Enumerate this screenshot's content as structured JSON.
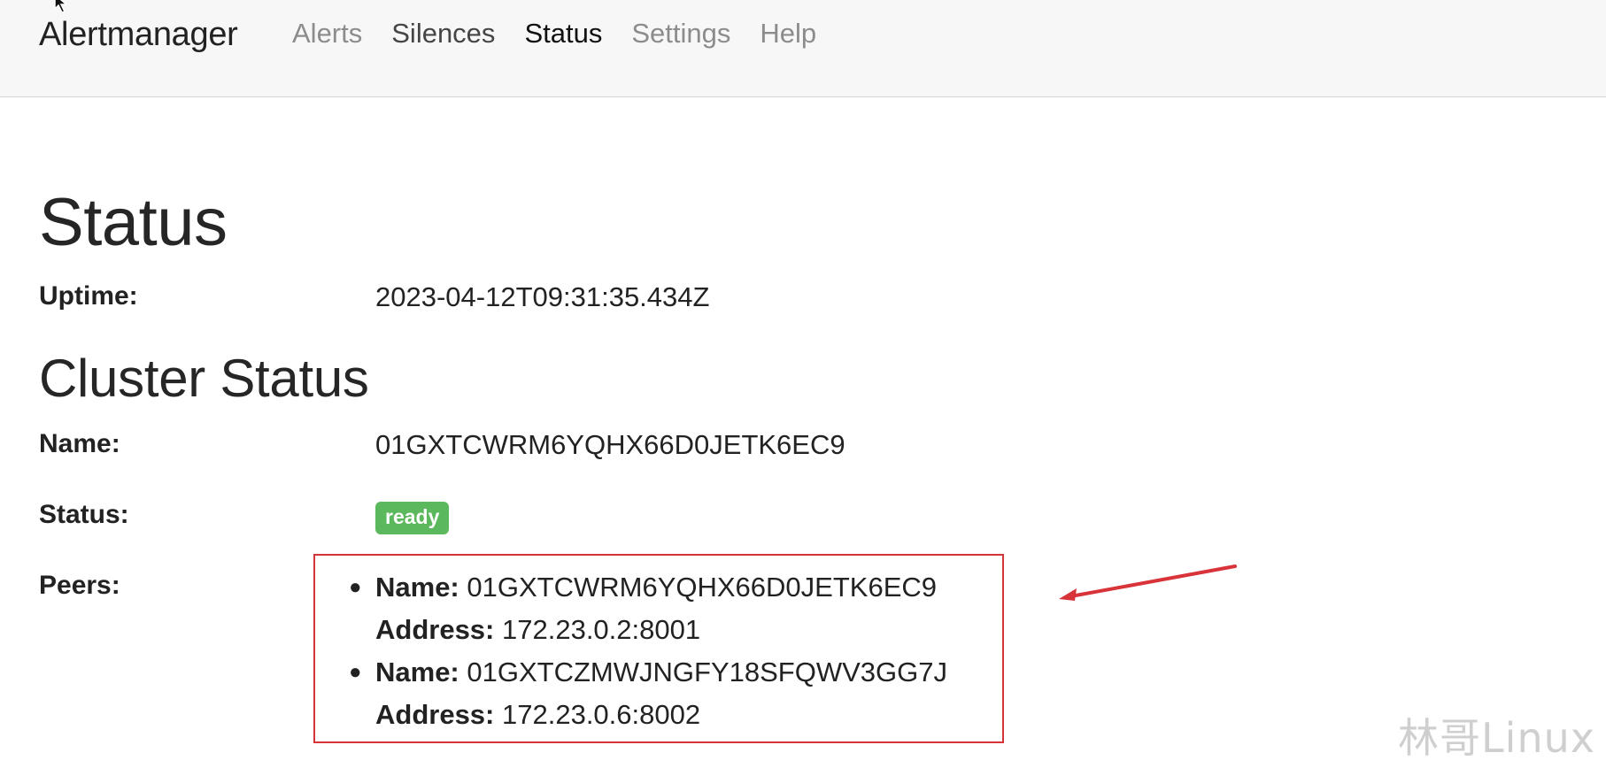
{
  "nav": {
    "brand": "Alertmanager",
    "links": [
      {
        "label": "Alerts"
      },
      {
        "label": "Silences"
      },
      {
        "label": "Status"
      },
      {
        "label": "Settings"
      },
      {
        "label": "Help"
      }
    ],
    "active": "Status"
  },
  "status": {
    "title": "Status",
    "uptime_label": "Uptime:",
    "uptime_value": "2023-04-12T09:31:35.434Z"
  },
  "cluster": {
    "title": "Cluster Status",
    "name_label": "Name:",
    "name_value": "01GXTCWRM6YQHX66D0JETK6EC9",
    "status_label": "Status:",
    "status_badge": "ready",
    "peers_label": "Peers:",
    "peers": [
      {
        "name_label": "Name:",
        "name": "01GXTCWRM6YQHX66D0JETK6EC9",
        "address_label": "Address:",
        "address": "172.23.0.2:8001"
      },
      {
        "name_label": "Name:",
        "name": "01GXTCZMWJNGFY18SFQWV3GG7J",
        "address_label": "Address:",
        "address": "172.23.0.6:8002"
      }
    ]
  },
  "annotation": {
    "highlight_color": "#d9333a",
    "arrow_color": "#d9333a"
  },
  "colors": {
    "badge_ready": "#5cb85c",
    "navbar_bg": "#f7f7f7"
  },
  "watermark": "林哥Linux"
}
